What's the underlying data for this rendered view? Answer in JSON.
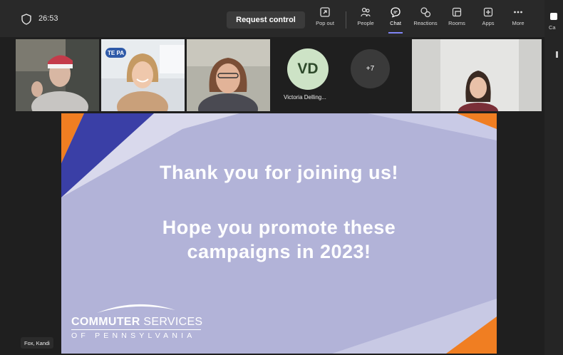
{
  "header": {
    "timer": "26:53",
    "request_control_label": "Request control",
    "tools": [
      {
        "label": "Pop out",
        "icon": "pop-out-icon"
      },
      {
        "label": "People",
        "icon": "people-icon"
      },
      {
        "label": "Chat",
        "icon": "chat-icon"
      },
      {
        "label": "Reactions",
        "icon": "reactions-icon"
      },
      {
        "label": "Rooms",
        "icon": "rooms-icon"
      },
      {
        "label": "Apps",
        "icon": "apps-icon"
      },
      {
        "label": "More",
        "icon": "more-icon"
      }
    ],
    "camera_label": "Ca",
    "active_tool": "Chat"
  },
  "participants": {
    "avatar_initials": "VD",
    "avatar_name": "Victoria Delling...",
    "overflow_count": "+7",
    "tile_badge": "TE PA"
  },
  "slide": {
    "line1": "Thank you for joining us!",
    "line2a": "Hope you promote these",
    "line2b": "campaigns in 2023!",
    "logo_bold": "COMMUTER",
    "logo_thin": "SERVICES",
    "logo_sub": "OF PENNSYLVANIA"
  },
  "presenter_name": "Fox, Kandi",
  "colors": {
    "accent": "#7f85f5",
    "slide_bg": "#b2b3d8",
    "slide_navy": "#3a3fa6",
    "slide_orange": "#f07e22",
    "avatar_bg": "#cde3c6"
  }
}
